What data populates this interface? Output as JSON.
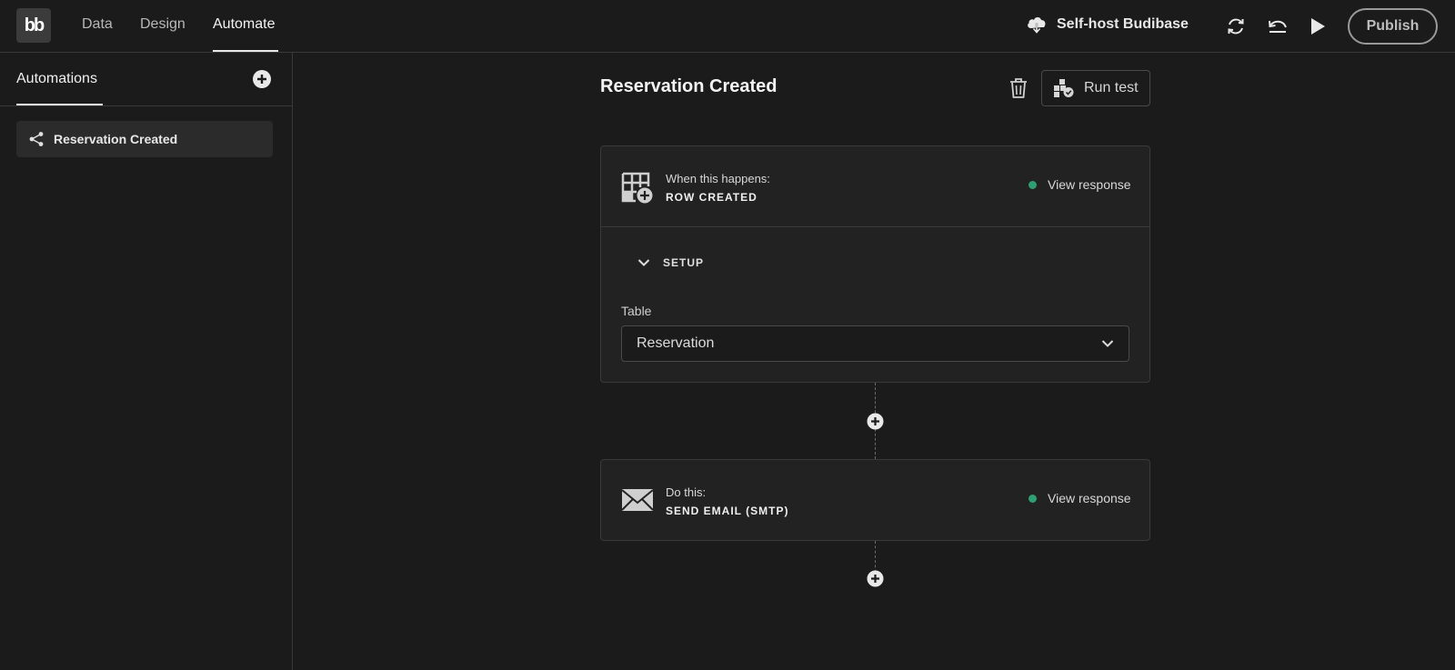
{
  "topbar": {
    "logo": "bb",
    "tabs": [
      {
        "label": "Data"
      },
      {
        "label": "Design"
      },
      {
        "label": "Automate"
      }
    ],
    "active_tab": "Automate",
    "selfhost_label": "Self-host Budibase",
    "publish_label": "Publish",
    "icons": [
      "cloud-download-icon",
      "refresh-icon",
      "undo-icon",
      "play-icon"
    ]
  },
  "sidebar": {
    "title": "Automations",
    "items": [
      {
        "label": "Reservation Created",
        "icon": "share-icon"
      }
    ]
  },
  "main": {
    "title": "Reservation Created",
    "run_test_label": "Run test",
    "trigger": {
      "subtitle": "When this happens:",
      "name": "ROW CREATED",
      "view_response": "View response",
      "setup_label": "SETUP",
      "field_label": "Table",
      "field_value": "Reservation",
      "status_color": "#2e9e74"
    },
    "action": {
      "subtitle": "Do this:",
      "name": "SEND EMAIL (SMTP)",
      "view_response": "View response",
      "status_color": "#2e9e74"
    }
  }
}
